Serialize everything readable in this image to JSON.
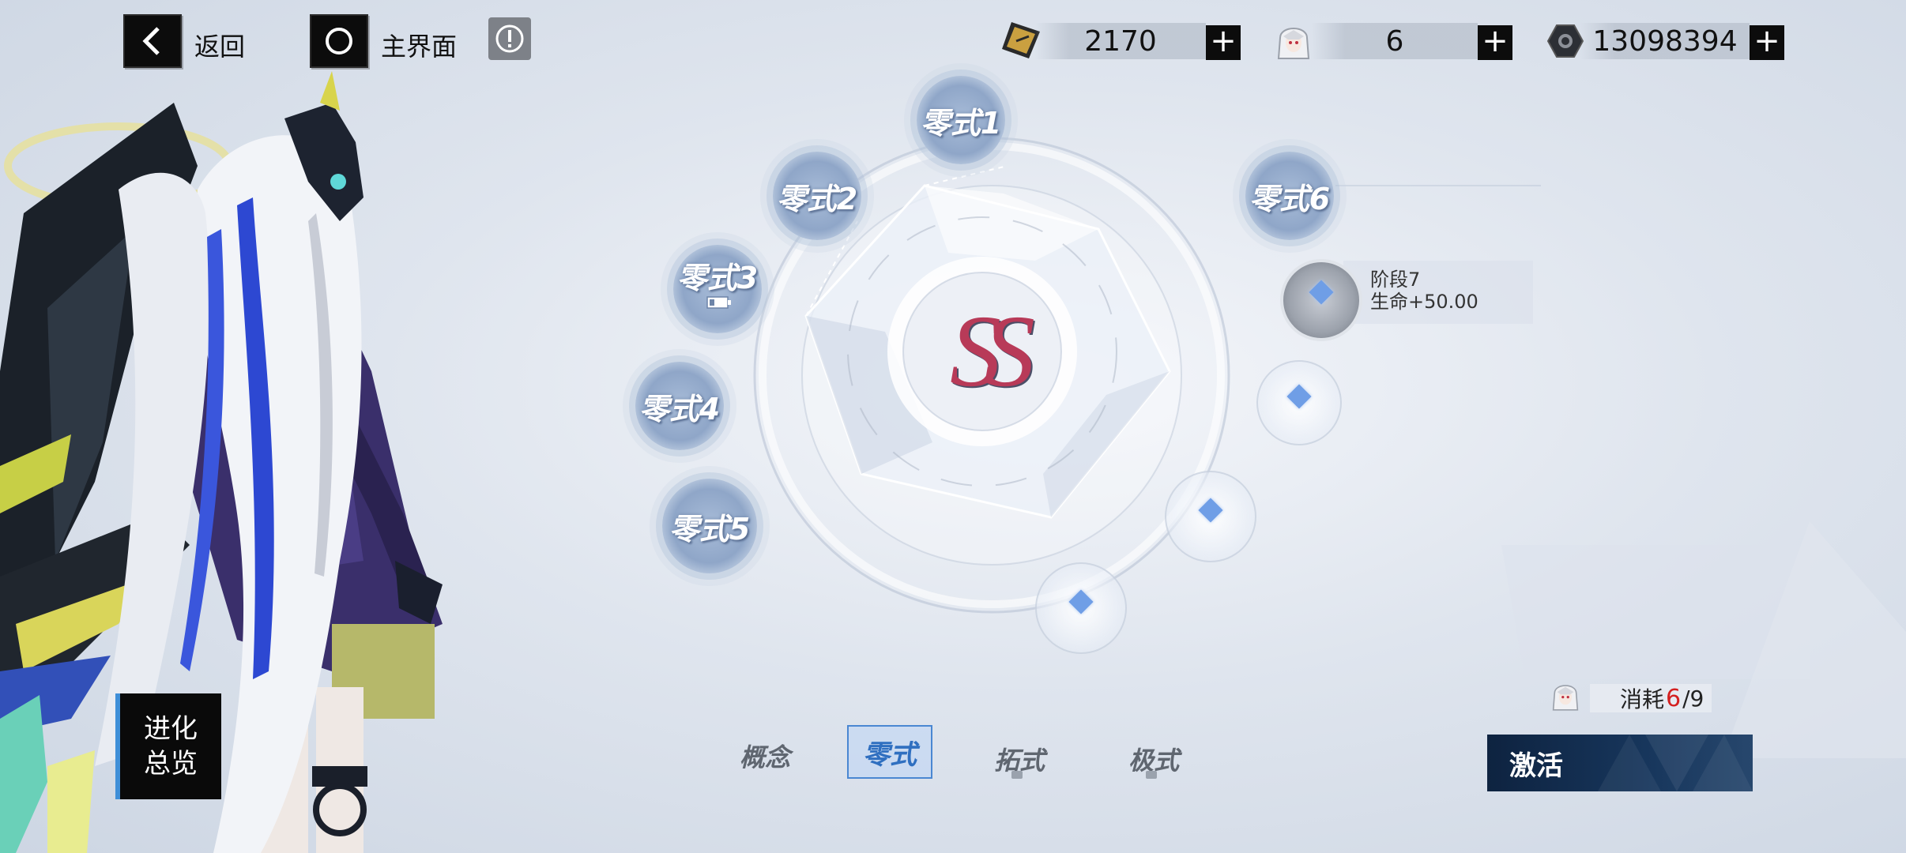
{
  "top_bar": {
    "back_label": "返回",
    "home_label": "主界面",
    "resources": [
      {
        "icon": "ticket-icon",
        "value": "2170"
      },
      {
        "icon": "character-avatar-icon",
        "value": "6"
      },
      {
        "icon": "hex-nut-icon",
        "value": "13098394"
      }
    ],
    "plus_symbol": "+"
  },
  "core": {
    "logo_text": "SS"
  },
  "nodes": [
    {
      "label": "零式1"
    },
    {
      "label": "零式2"
    },
    {
      "label": "零式3"
    },
    {
      "label": "零式4"
    },
    {
      "label": "零式5"
    },
    {
      "label": "零式6"
    }
  ],
  "stage": {
    "title": "阶段7",
    "stat": "生命+50.00"
  },
  "evolution_overview": {
    "line1": "进化",
    "line2": "总览"
  },
  "tabs": [
    {
      "label": "概念",
      "locked": false
    },
    {
      "label": "零式",
      "locked": false,
      "active": true
    },
    {
      "label": "拓式",
      "locked": true
    },
    {
      "label": "极式",
      "locked": true
    }
  ],
  "cost": {
    "prefix": "消耗",
    "current": "6",
    "total": "/9"
  },
  "activate_label": "激活",
  "colors": {
    "accent_blue": "#2f6fc0",
    "activate_bg": "#17365c",
    "cost_red": "#d42020"
  }
}
